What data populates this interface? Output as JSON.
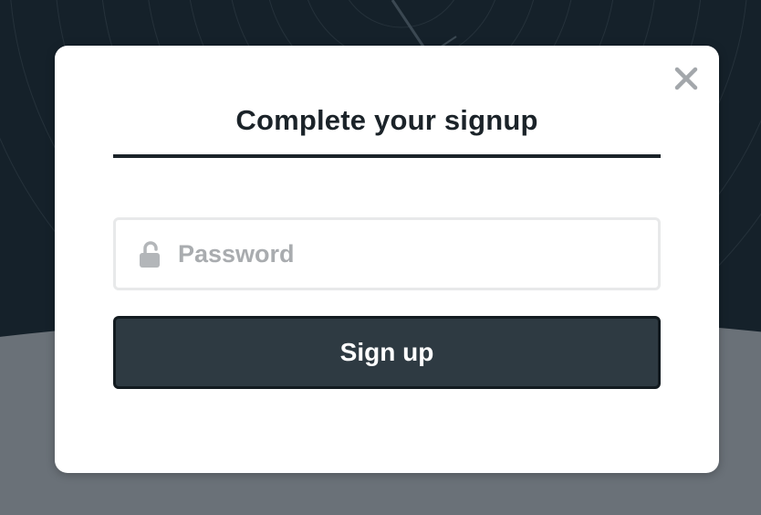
{
  "modal": {
    "title": "Complete your signup",
    "close_icon": "close-icon"
  },
  "password": {
    "placeholder": "Password",
    "value": "",
    "icon": "unlocked-lock-icon"
  },
  "actions": {
    "signup_label": "Sign up"
  },
  "colors": {
    "backdrop_dark": "#15212a",
    "backdrop_ground": "#6a7178",
    "modal_bg": "#ffffff",
    "title_text": "#1b2329",
    "button_bg": "#2e3a42",
    "button_border": "#131b20",
    "input_border": "#e8e9ea",
    "placeholder": "#a9acaf",
    "close_icon": "#a3a7ab"
  }
}
